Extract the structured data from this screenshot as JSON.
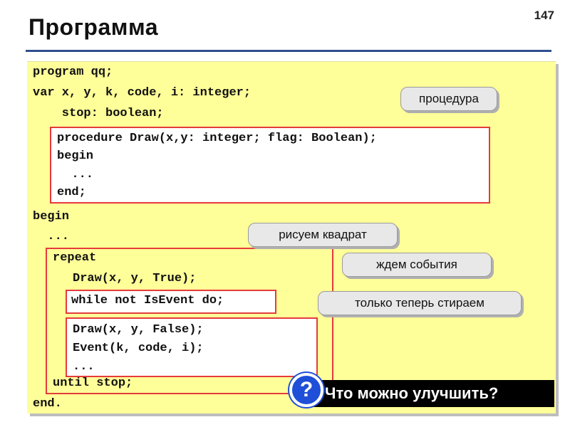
{
  "slide": {
    "number": "147",
    "title": "Программа"
  },
  "code": {
    "line1": "program qq;",
    "line2": "var x, y, k, code, i: integer;",
    "line3": "    stop: boolean;",
    "proc1": "procedure Draw(x,y: integer; flag: Boolean);",
    "proc2": "begin",
    "proc3": "  ...",
    "proc4": "end;",
    "begin": "begin",
    "dots": "  ...",
    "repeat": "repeat",
    "draw_true": "Draw(x, y, True);",
    "while": "while not IsEvent do;",
    "draw_false": "Draw(x, y, False);",
    "event": "Event(k, code, i);",
    "dots2": "...",
    "until": "until stop;",
    "end": "end."
  },
  "callouts": {
    "procedure": "процедура",
    "draw_square": "рисуем квадрат",
    "wait_event": "ждем события",
    "erase_now": "только теперь стираем"
  },
  "question": {
    "badge": "?",
    "text": "Что можно улучшить?"
  },
  "colors": {
    "panel": "#ffff99",
    "box_border": "#e43b3b",
    "rule": "#2f4f8f",
    "question_badge": "#1f4fd8"
  }
}
